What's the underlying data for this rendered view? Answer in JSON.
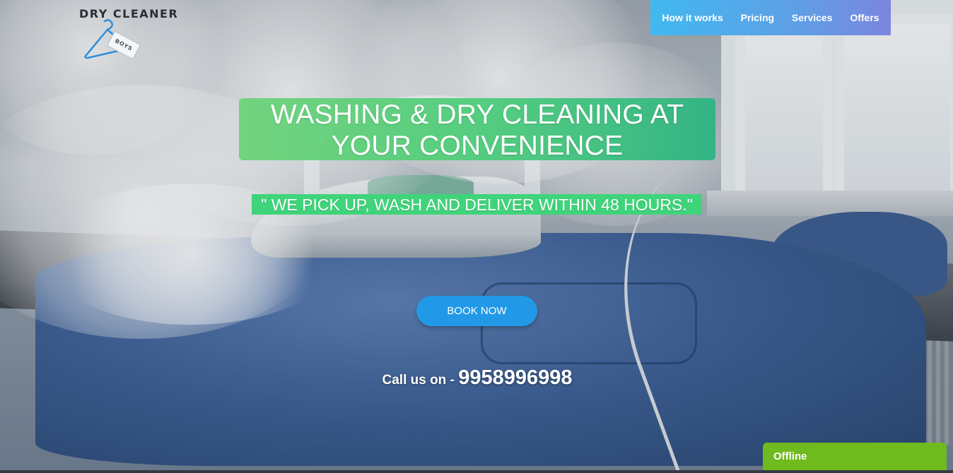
{
  "logo": {
    "text": "DRY CLEANER",
    "tag_text": "BOYS",
    "icon": "hanger-icon"
  },
  "nav": {
    "items": [
      {
        "label": "How it works"
      },
      {
        "label": "Pricing"
      },
      {
        "label": "Services"
      },
      {
        "label": "Offers"
      }
    ]
  },
  "hero": {
    "headline_line1": "WASHING & DRY CLEANING AT",
    "headline_line2": "YOUR CONVENIENCE",
    "tagline": "\" WE PICK UP, WASH AND DELIVER WITHIN 48 HOURS.\"",
    "cta_label": "BOOK NOW",
    "call_label": "Call us on - ",
    "phone": "9958996998"
  },
  "chat_widget": {
    "status": "Offline"
  },
  "colors": {
    "nav_start": "#41b9f0",
    "nav_end": "#7b86dd",
    "headline_green": "#4fcd7b",
    "cta_blue": "#2299e6",
    "offline_green": "#6fba1e"
  }
}
